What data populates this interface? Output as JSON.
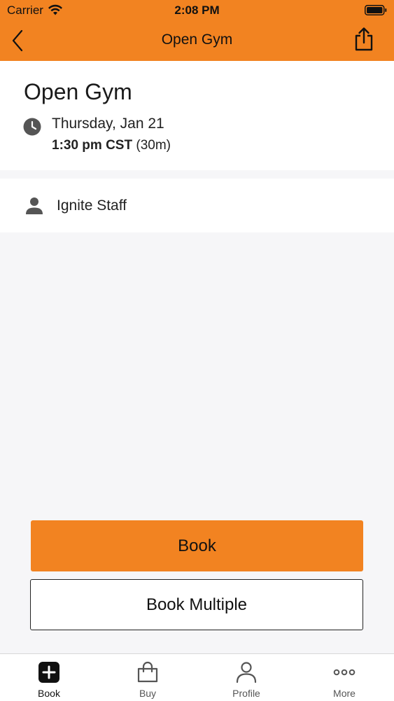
{
  "status_bar": {
    "carrier": "Carrier",
    "time": "2:08 PM"
  },
  "nav": {
    "title": "Open Gym",
    "back_icon": "chevron-left-icon",
    "share_icon": "share-icon"
  },
  "class": {
    "title": "Open Gym",
    "date": "Thursday, Jan 21",
    "time": "1:30 pm CST",
    "duration": "(30m)",
    "staff": "Ignite Staff"
  },
  "actions": {
    "book_label": "Book",
    "book_multiple_label": "Book Multiple"
  },
  "tabs": [
    {
      "label": "Book",
      "icon": "plus-square-icon",
      "active": true
    },
    {
      "label": "Buy",
      "icon": "shopping-bag-icon",
      "active": false
    },
    {
      "label": "Profile",
      "icon": "person-icon",
      "active": false
    },
    {
      "label": "More",
      "icon": "more-dots-icon",
      "active": false
    }
  ],
  "colors": {
    "brand": "#f28321",
    "background": "#f6f6f8",
    "icon_gray": "#555555"
  }
}
